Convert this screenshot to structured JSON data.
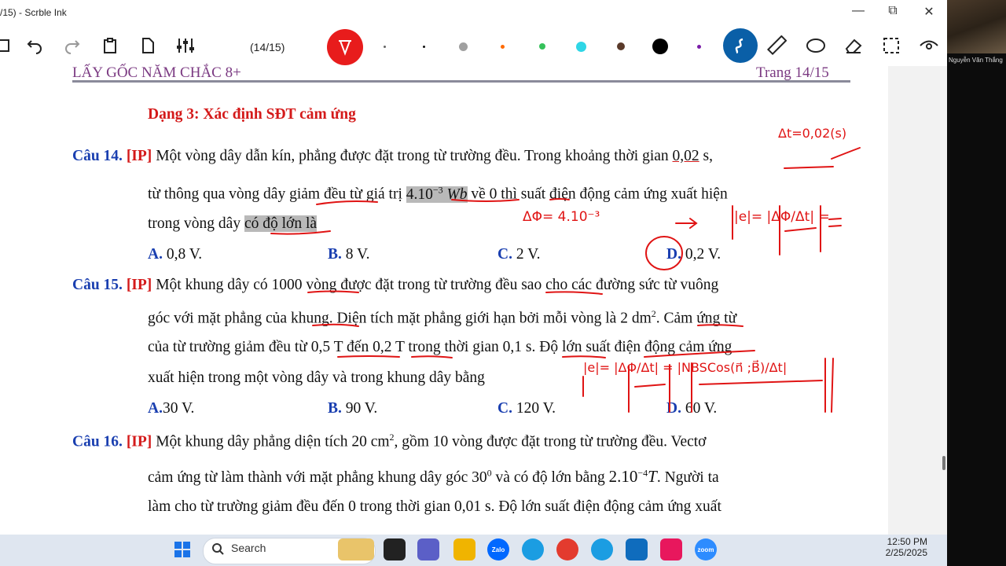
{
  "window": {
    "title": "/15) - Scrble Ink",
    "minimize": "—",
    "maximize": "⧉",
    "close": "✕"
  },
  "toolbar": {
    "page_indicator": "(14/15)",
    "colors": [
      "#666666",
      "#111111",
      "#a0a0a0",
      "#ff6a00",
      "#35c15a",
      "#2fd6e6",
      "#5a3a2a",
      "#000000",
      "#7a1ca8"
    ]
  },
  "document": {
    "header_left": "LẤY GỐC NĂM CHẮC 8+",
    "header_right": "Trang 14/15",
    "section_title": "Dạng 3: Xác định SĐT cảm ứng",
    "q14": {
      "label": "Câu 14.",
      "tag": "[IP]",
      "line1a": "Một vòng dây dẫn kín, phẳng được đặt trong từ trường đều. Trong khoảng thời gian ",
      "line1b": "0,02",
      "line1c": " s,",
      "line2a": "từ thông qua vòng dây giảm đều từ giá trị ",
      "line2b": "4.10",
      "line2exp": "−3",
      "line2c": " Wb",
      "line2d": " về 0 thì suất điện động cảm ứng xuất hiện",
      "line3a": "trong vòng dây ",
      "line3b": "có độ lớn là",
      "answers": [
        {
          "key": "A.",
          "text": " 0,8 V."
        },
        {
          "key": "B.",
          "text": " 8 V."
        },
        {
          "key": "C.",
          "text": " 2 V."
        },
        {
          "key": "D.",
          "text": " 0,2 V."
        }
      ]
    },
    "q15": {
      "label": "Câu 15.",
      "tag": "[IP]",
      "line1": "Một khung dây có 1000 vòng được đặt trong từ trường đều sao cho các đường sức từ vuông",
      "line2a": "góc với mặt phẳng của khung. Diện tích mặt phẳng giới hạn bởi mỗi vòng là 2 dm",
      "line2exp": "2",
      "line2b": ". Cảm ứng từ",
      "line3": "của từ trường giảm đều từ 0,5 T đến 0,2 T trong thời gian 0,1 s. Độ lớn suất điện động cảm ứng",
      "line4": "xuất hiện trong một vòng dây và trong khung dây bằng",
      "answers": [
        {
          "key": "A.",
          "text": "30 V."
        },
        {
          "key": "B.",
          "text": " 90 V."
        },
        {
          "key": "C.",
          "text": " 120 V."
        },
        {
          "key": "D.",
          "text": " 60 V."
        }
      ]
    },
    "q16": {
      "label": "Câu 16.",
      "tag": "[IP]",
      "line1a": "Một khung dây phẳng diện tích 20 cm",
      "line1exp": "2",
      "line1b": ", gồm 10 vòng được đặt trong từ trường đều. Vectơ",
      "line2a": "cảm ứng từ làm thành với mặt phẳng khung dây góc 30",
      "line2exp": "0",
      "line2b": " và có độ lớn bằng ",
      "line2c": "2.10",
      "line2exp2": "−4",
      "line2d": "T",
      "line2e": ". Người ta",
      "line3": "làm cho từ trường giảm đều đến 0 trong thời gian 0,01 s. Độ lớn suất điện động cảm ứng xuất"
    }
  },
  "annotations": {
    "dt": "Δt=0,02(s)",
    "dphi": "ΔΦ= 4.10⁻³",
    "arrow": "→",
    "emf": "|e|= |ΔΦ/Δt| =",
    "emf2": "|e|= |ΔΦ/Δt| = |NBSCos(n⃗ ;B⃗)/Δt|"
  },
  "webcam": {
    "name": "Nguyễn Văn Thắng"
  },
  "taskbar": {
    "search_placeholder": "Search",
    "time": "12:50 PM",
    "date": "2/25/2025",
    "apps": [
      "Zalo",
      "zoom"
    ]
  }
}
